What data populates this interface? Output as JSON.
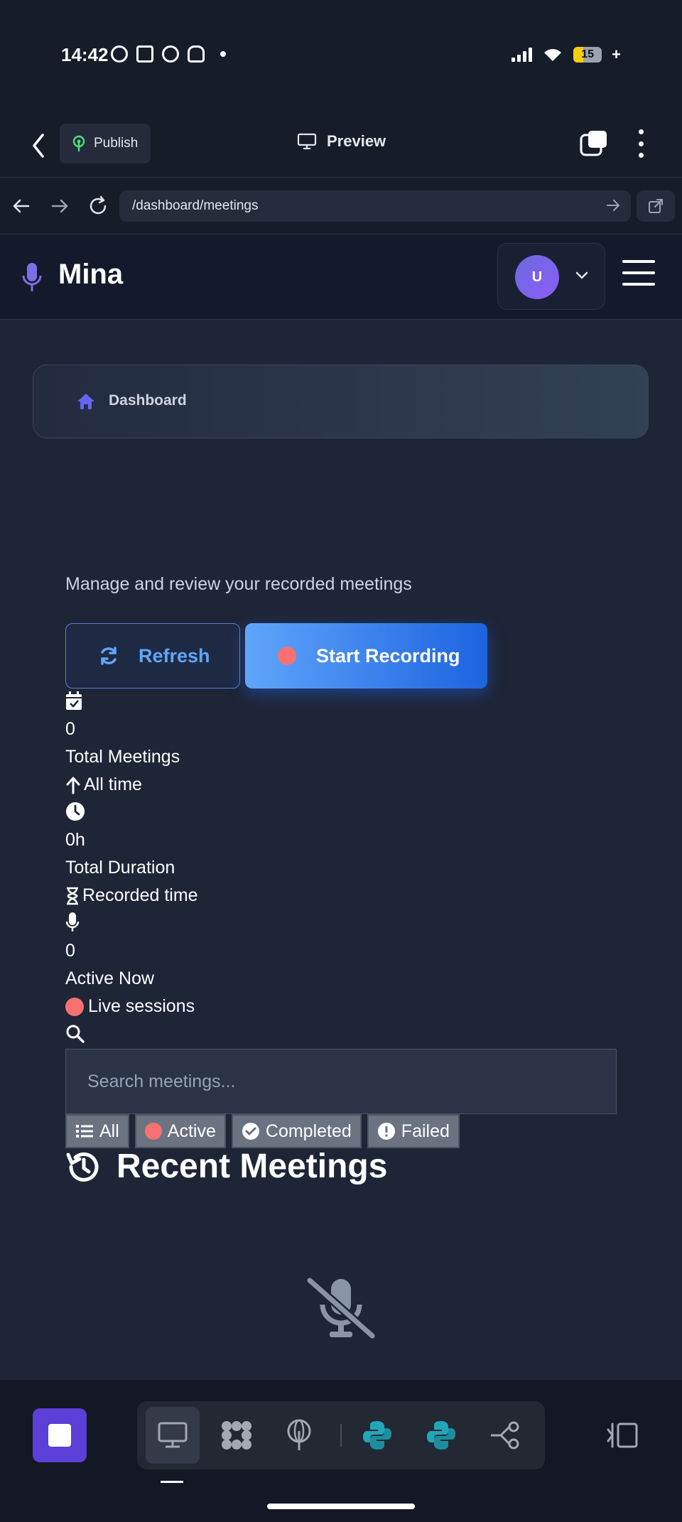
{
  "status_bar": {
    "time": "14:42",
    "battery": "15",
    "icons": [
      "whatsapp-icon",
      "slack-icon",
      "messages-icon",
      "snapchat-icon",
      "signal-icon",
      "wifi-icon",
      "battery-icon"
    ]
  },
  "app_bar": {
    "publish_label": "Publish",
    "preview_label": "Preview"
  },
  "browser": {
    "url": "/dashboard/meetings"
  },
  "site_header": {
    "brand": "Mina",
    "avatar_initial": "U"
  },
  "breadcrumb": {
    "label": "Dashboard"
  },
  "main": {
    "subtitle": "Manage and review your recorded meetings",
    "refresh_label": "Refresh",
    "record_label": "Start Recording"
  },
  "stats": [
    {
      "value": "0",
      "label": "Total Meetings",
      "note": "All time",
      "icon": "calendar-check-icon",
      "note_icon": "arrow-up-icon"
    },
    {
      "value": "0h",
      "label": "Total Duration",
      "note": "Recorded time",
      "icon": "clock-icon",
      "note_icon": "hourglass-icon"
    },
    {
      "value": "0",
      "label": "Active Now",
      "note": "Live sessions",
      "icon": "microphone-icon",
      "note_icon": "red-dot-icon"
    }
  ],
  "search": {
    "placeholder": "Search meetings..."
  },
  "filters": [
    "All",
    "Active",
    "Completed",
    "Failed"
  ],
  "recent": {
    "title": "Recent Meetings"
  },
  "colors": {
    "accent": "#2563eb",
    "brand_purple": "#5b3fd6",
    "live_red": "#f87171"
  }
}
